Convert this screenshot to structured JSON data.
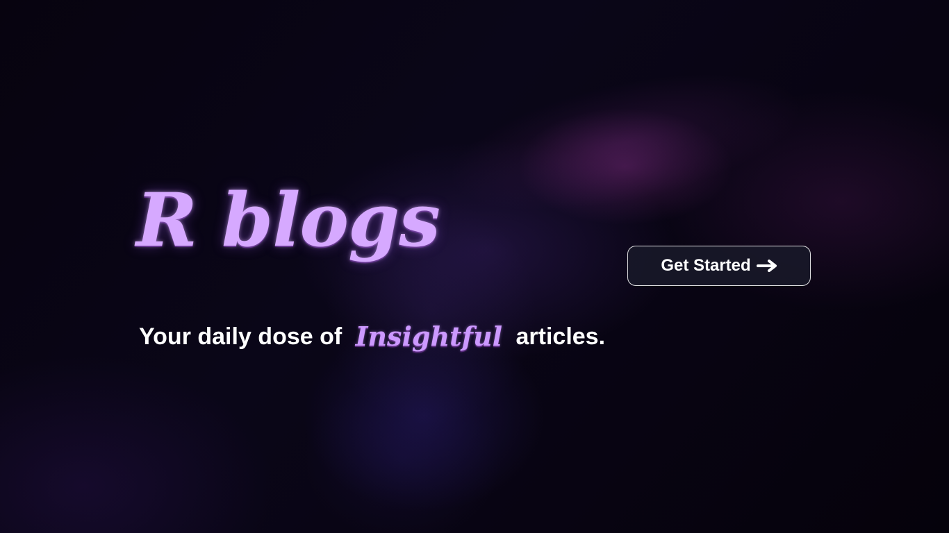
{
  "hero": {
    "brand_title": "R blogs",
    "tagline": {
      "prefix": "Your daily dose of",
      "highlight": "Insightful",
      "suffix": "articles."
    }
  },
  "cta": {
    "label": "Get Started",
    "icon": "arrow-right-icon"
  },
  "colors": {
    "background": "#07030F",
    "brand_text": "#D6A9FF",
    "highlight_text": "#CC99FF",
    "button_background": "#181828",
    "button_border": "#FFFFFF",
    "text": "#FFFFFF"
  }
}
